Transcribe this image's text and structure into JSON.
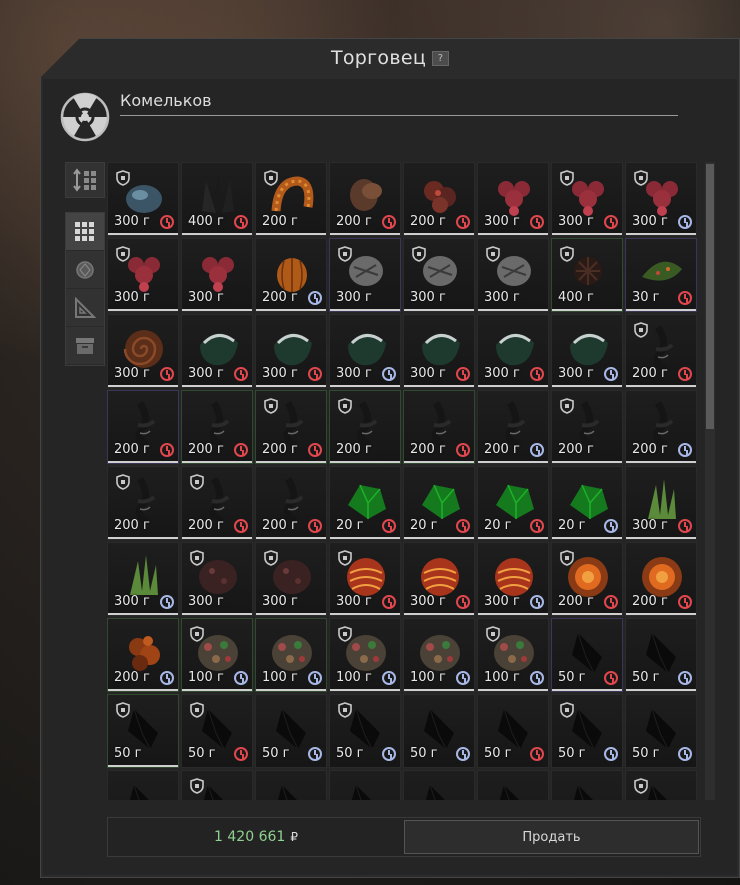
{
  "window": {
    "title": "Торговец",
    "help": "?"
  },
  "trader": {
    "name": "Комельков",
    "logo_icon": "radiation-icon"
  },
  "sort": {
    "icon": "sort-icon"
  },
  "filters": [
    {
      "icon": "grid-icon",
      "active": true
    },
    {
      "icon": "artifact-icon",
      "active": false
    },
    {
      "icon": "ruler-icon",
      "active": false
    },
    {
      "icon": "box-icon",
      "active": false
    }
  ],
  "items": [
    {
      "price": "300 г",
      "shield": true,
      "timer": "red",
      "art": "blue-rock",
      "bar": true,
      "border": ""
    },
    {
      "price": "400 г",
      "shield": false,
      "timer": "red",
      "art": "dark-spike",
      "bar": true,
      "border": ""
    },
    {
      "price": "200 г",
      "shield": true,
      "timer": "",
      "art": "orange-worm",
      "bar": true,
      "border": ""
    },
    {
      "price": "200 г",
      "shield": false,
      "timer": "red",
      "art": "brown-rock",
      "bar": true,
      "border": ""
    },
    {
      "price": "200 г",
      "shield": false,
      "timer": "red",
      "art": "red-cluster",
      "bar": true,
      "border": ""
    },
    {
      "price": "300 г",
      "shield": false,
      "timer": "red",
      "art": "red-flower",
      "bar": true,
      "border": ""
    },
    {
      "price": "300 г",
      "shield": true,
      "timer": "red",
      "art": "red-flower",
      "bar": true,
      "border": ""
    },
    {
      "price": "300 г",
      "shield": true,
      "timer": "blue",
      "art": "red-flower",
      "bar": true,
      "border": ""
    },
    {
      "price": "300 г",
      "shield": true,
      "timer": "",
      "art": "red-flower",
      "bar": true,
      "border": ""
    },
    {
      "price": "300 г",
      "shield": false,
      "timer": "",
      "art": "red-flower",
      "bar": true,
      "border": ""
    },
    {
      "price": "200 г",
      "shield": false,
      "timer": "blue",
      "art": "orange-pumpkin",
      "bar": true,
      "border": ""
    },
    {
      "price": "300 г",
      "shield": true,
      "timer": "",
      "art": "gray-rock",
      "bar": true,
      "border": "purple"
    },
    {
      "price": "300 г",
      "shield": true,
      "timer": "",
      "art": "gray-rock",
      "bar": true,
      "border": ""
    },
    {
      "price": "300 г",
      "shield": true,
      "timer": "",
      "art": "gray-rock",
      "bar": true,
      "border": ""
    },
    {
      "price": "400 г",
      "shield": true,
      "timer": "",
      "art": "dark-cluster",
      "bar": true,
      "border": "green"
    },
    {
      "price": "30 г",
      "shield": false,
      "timer": "red",
      "art": "green-leaf",
      "bar": true,
      "border": "purple"
    },
    {
      "price": "300 г",
      "shield": false,
      "timer": "red",
      "art": "brown-spiral",
      "bar": true,
      "border": ""
    },
    {
      "price": "300 г",
      "shield": false,
      "timer": "red",
      "art": "green-shell",
      "bar": true,
      "border": ""
    },
    {
      "price": "300 г",
      "shield": false,
      "timer": "red",
      "art": "green-shell",
      "bar": true,
      "border": ""
    },
    {
      "price": "300 г",
      "shield": false,
      "timer": "blue",
      "art": "green-shell",
      "bar": true,
      "border": ""
    },
    {
      "price": "300 г",
      "shield": false,
      "timer": "red",
      "art": "green-shell",
      "bar": true,
      "border": ""
    },
    {
      "price": "300 г",
      "shield": false,
      "timer": "red",
      "art": "green-shell",
      "bar": true,
      "border": ""
    },
    {
      "price": "300 г",
      "shield": false,
      "timer": "blue",
      "art": "green-shell",
      "bar": true,
      "border": ""
    },
    {
      "price": "200 г",
      "shield": true,
      "timer": "red",
      "art": "dark-branch",
      "bar": true,
      "border": ""
    },
    {
      "price": "200 г",
      "shield": false,
      "timer": "red",
      "art": "dark-branch",
      "bar": true,
      "border": "purple"
    },
    {
      "price": "200 г",
      "shield": false,
      "timer": "red",
      "art": "dark-branch",
      "bar": true,
      "border": "green"
    },
    {
      "price": "200 г",
      "shield": true,
      "timer": "red",
      "art": "dark-branch",
      "bar": true,
      "border": "green"
    },
    {
      "price": "200 г",
      "shield": true,
      "timer": "",
      "art": "dark-branch",
      "bar": true,
      "border": "green"
    },
    {
      "price": "200 г",
      "shield": false,
      "timer": "red",
      "art": "dark-branch",
      "bar": true,
      "border": "green"
    },
    {
      "price": "200 г",
      "shield": false,
      "timer": "blue",
      "art": "dark-branch",
      "bar": true,
      "border": ""
    },
    {
      "price": "200 г",
      "shield": true,
      "timer": "",
      "art": "dark-branch",
      "bar": true,
      "border": ""
    },
    {
      "price": "200 г",
      "shield": false,
      "timer": "blue",
      "art": "dark-branch",
      "bar": true,
      "border": ""
    },
    {
      "price": "200 г",
      "shield": true,
      "timer": "",
      "art": "dark-branch",
      "bar": true,
      "border": ""
    },
    {
      "price": "200 г",
      "shield": true,
      "timer": "red",
      "art": "dark-branch",
      "bar": true,
      "border": ""
    },
    {
      "price": "200 г",
      "shield": false,
      "timer": "red",
      "art": "dark-branch",
      "bar": true,
      "border": ""
    },
    {
      "price": "20 г",
      "shield": false,
      "timer": "red",
      "art": "green-crystal",
      "bar": true,
      "border": ""
    },
    {
      "price": "20 г",
      "shield": false,
      "timer": "red",
      "art": "green-crystal",
      "bar": true,
      "border": ""
    },
    {
      "price": "20 г",
      "shield": false,
      "timer": "red",
      "art": "green-crystal",
      "bar": true,
      "border": ""
    },
    {
      "price": "20 г",
      "shield": false,
      "timer": "blue",
      "art": "green-crystal",
      "bar": true,
      "border": ""
    },
    {
      "price": "300 г",
      "shield": false,
      "timer": "red",
      "art": "green-spikes",
      "bar": true,
      "border": ""
    },
    {
      "price": "300 г",
      "shield": false,
      "timer": "blue",
      "art": "green-spikes",
      "bar": true,
      "border": ""
    },
    {
      "price": "300 г",
      "shield": true,
      "timer": "",
      "art": "dark-red-rock",
      "bar": true,
      "border": ""
    },
    {
      "price": "300 г",
      "shield": true,
      "timer": "",
      "art": "dark-red-rock",
      "bar": true,
      "border": ""
    },
    {
      "price": "300 г",
      "shield": true,
      "timer": "red",
      "art": "red-orb",
      "bar": true,
      "border": ""
    },
    {
      "price": "300 г",
      "shield": false,
      "timer": "red",
      "art": "red-orb",
      "bar": true,
      "border": ""
    },
    {
      "price": "300 г",
      "shield": false,
      "timer": "blue",
      "art": "red-orb",
      "bar": true,
      "border": ""
    },
    {
      "price": "200 г",
      "shield": true,
      "timer": "red",
      "art": "glow-orb",
      "bar": true,
      "border": ""
    },
    {
      "price": "200 г",
      "shield": false,
      "timer": "red",
      "art": "glow-orb",
      "bar": true,
      "border": ""
    },
    {
      "price": "200 г",
      "shield": false,
      "timer": "blue",
      "art": "orange-cluster",
      "bar": true,
      "border": "green"
    },
    {
      "price": "100 г",
      "shield": true,
      "timer": "blue",
      "art": "coral",
      "bar": true,
      "border": "green"
    },
    {
      "price": "100 г",
      "shield": false,
      "timer": "blue",
      "art": "coral",
      "bar": true,
      "border": "green"
    },
    {
      "price": "100 г",
      "shield": true,
      "timer": "blue",
      "art": "coral",
      "bar": true,
      "border": ""
    },
    {
      "price": "100 г",
      "shield": false,
      "timer": "blue",
      "art": "coral",
      "bar": true,
      "border": ""
    },
    {
      "price": "100 г",
      "shield": true,
      "timer": "blue",
      "art": "coral",
      "bar": true,
      "border": ""
    },
    {
      "price": "50 г",
      "shield": false,
      "timer": "red",
      "art": "black-shard",
      "bar": true,
      "border": "purple"
    },
    {
      "price": "50 г",
      "shield": false,
      "timer": "blue",
      "art": "black-shard",
      "bar": true,
      "border": ""
    },
    {
      "price": "50 г",
      "shield": true,
      "timer": "",
      "art": "black-shard",
      "bar": true,
      "border": "green"
    },
    {
      "price": "50 г",
      "shield": true,
      "timer": "red",
      "art": "black-shard",
      "bar": false,
      "border": ""
    },
    {
      "price": "50 г",
      "shield": false,
      "timer": "blue",
      "art": "black-shard",
      "bar": false,
      "border": ""
    },
    {
      "price": "50 г",
      "shield": true,
      "timer": "blue",
      "art": "black-shard",
      "bar": false,
      "border": ""
    },
    {
      "price": "50 г",
      "shield": false,
      "timer": "blue",
      "art": "black-shard",
      "bar": false,
      "border": ""
    },
    {
      "price": "50 г",
      "shield": false,
      "timer": "red",
      "art": "black-shard",
      "bar": false,
      "border": ""
    },
    {
      "price": "50 г",
      "shield": true,
      "timer": "blue",
      "art": "black-shard",
      "bar": false,
      "border": ""
    },
    {
      "price": "50 г",
      "shield": false,
      "timer": "blue",
      "art": "black-shard",
      "bar": false,
      "border": ""
    },
    {
      "price": "",
      "shield": false,
      "timer": "",
      "art": "black-shard",
      "bar": false,
      "border": ""
    },
    {
      "price": "",
      "shield": true,
      "timer": "",
      "art": "black-shard",
      "bar": false,
      "border": ""
    },
    {
      "price": "",
      "shield": false,
      "timer": "",
      "art": "black-shard",
      "bar": false,
      "border": ""
    },
    {
      "price": "",
      "shield": false,
      "timer": "",
      "art": "black-shard",
      "bar": false,
      "border": ""
    },
    {
      "price": "",
      "shield": false,
      "timer": "",
      "art": "black-shard",
      "bar": false,
      "border": ""
    },
    {
      "price": "",
      "shield": false,
      "timer": "",
      "art": "black-shard",
      "bar": false,
      "border": ""
    },
    {
      "price": "",
      "shield": false,
      "timer": "",
      "art": "black-shard",
      "bar": false,
      "border": ""
    },
    {
      "price": "",
      "shield": true,
      "timer": "",
      "art": "black-shard",
      "bar": false,
      "border": ""
    }
  ],
  "footer": {
    "money": "1 420 661",
    "currency": "₽",
    "sell_label": "Продать"
  },
  "colors": {
    "money": "#8fd18f",
    "timer_red": "#e2474e",
    "timer_blue": "#a8b8e6"
  }
}
